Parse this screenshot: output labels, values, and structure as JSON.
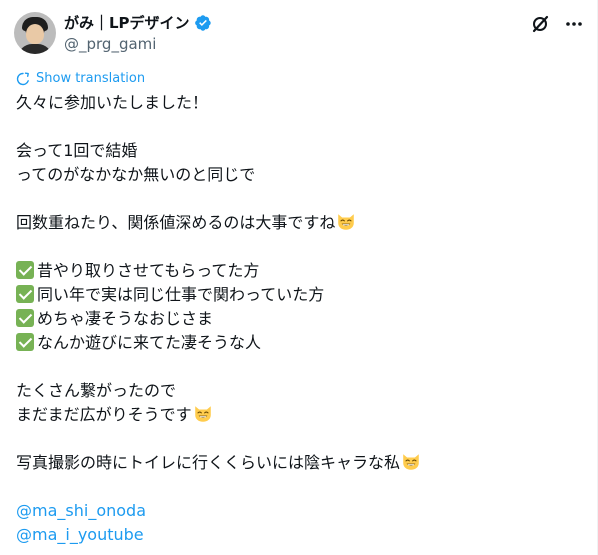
{
  "author": {
    "name": "がみ｜LPデザイン",
    "handle": "@_prg_gami"
  },
  "translate_label": "Show translation",
  "lines": {
    "l1": "久々に参加いたしました！",
    "l2": "会って1回で結婚",
    "l3": "ってのがなかなか無いのと同じで",
    "l4": "回数重ねたり、関係値深めるのは大事ですね",
    "l5": "昔やり取りさせてもらってた方",
    "l6": "同い年で実は同じ仕事で関わっていた方",
    "l7": "めちゃ凄そうなおじさま",
    "l8": "なんか遊びに来てた凄そうな人",
    "l9": "たくさん繋がったので",
    "l10": "まだまだ広がりそうです",
    "l11": "写真撮影の時にトイレに行くくらいには陰キャラな私",
    "m1": "@ma_shi_onoda",
    "m2": "@ma_i_youtube"
  },
  "colors": {
    "link": "#1d9bf0",
    "text": "#0f1419",
    "secondary": "#536471",
    "check": "#77b255",
    "verified": "#1d9bf0"
  },
  "icons": {
    "verified": "verified-badge-icon",
    "grok": "grok-icon",
    "more": "more-icon",
    "translate": "translate-icon",
    "check": "check-mark-button-icon",
    "emoji": "grinning-cat-emoji-icon"
  }
}
